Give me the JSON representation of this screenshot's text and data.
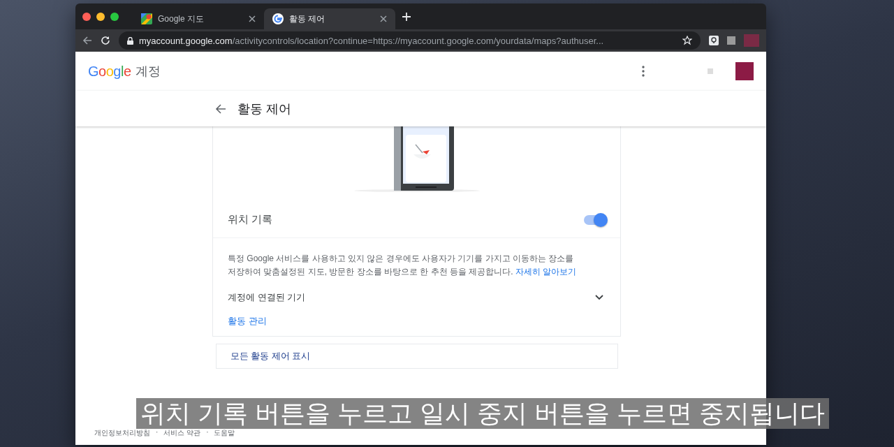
{
  "browser": {
    "tabs": [
      {
        "title": "Google 지도",
        "selected": false
      },
      {
        "title": "활동 제어",
        "selected": true
      }
    ],
    "address": {
      "host": "myaccount.google.com",
      "path": "/activitycontrols/location?continue=https://myaccount.google.com/yourdata/maps?authuser..."
    }
  },
  "header": {
    "logo": "Google",
    "product": "계정"
  },
  "subheader": {
    "title": "활동 제어"
  },
  "setting": {
    "title": "위치 기록",
    "on": true,
    "description": "특정 Google 서비스를 사용하고 있지 않은 경우에도 사용자가 기기를 가지고 이동하는 장소를 저장하여 맞춤설정된 지도, 방문한 장소를 바탕으로 한 추천 등을 제공합니다.",
    "learn_more": "자세히 알아보기",
    "devices": {
      "label": "계정에 연결된 기기",
      "expanded": false
    },
    "manage_link": "활동 관리"
  },
  "all_controls_link": "모든 활동 제어 표시",
  "footer": {
    "links": [
      "개인정보처리방침",
      "서비스 약관",
      "도움말"
    ],
    "separator": "·"
  },
  "caption": "위치 기록 버튼을 누르고 일시 중지 버튼을 누르면 중지됩니다"
}
